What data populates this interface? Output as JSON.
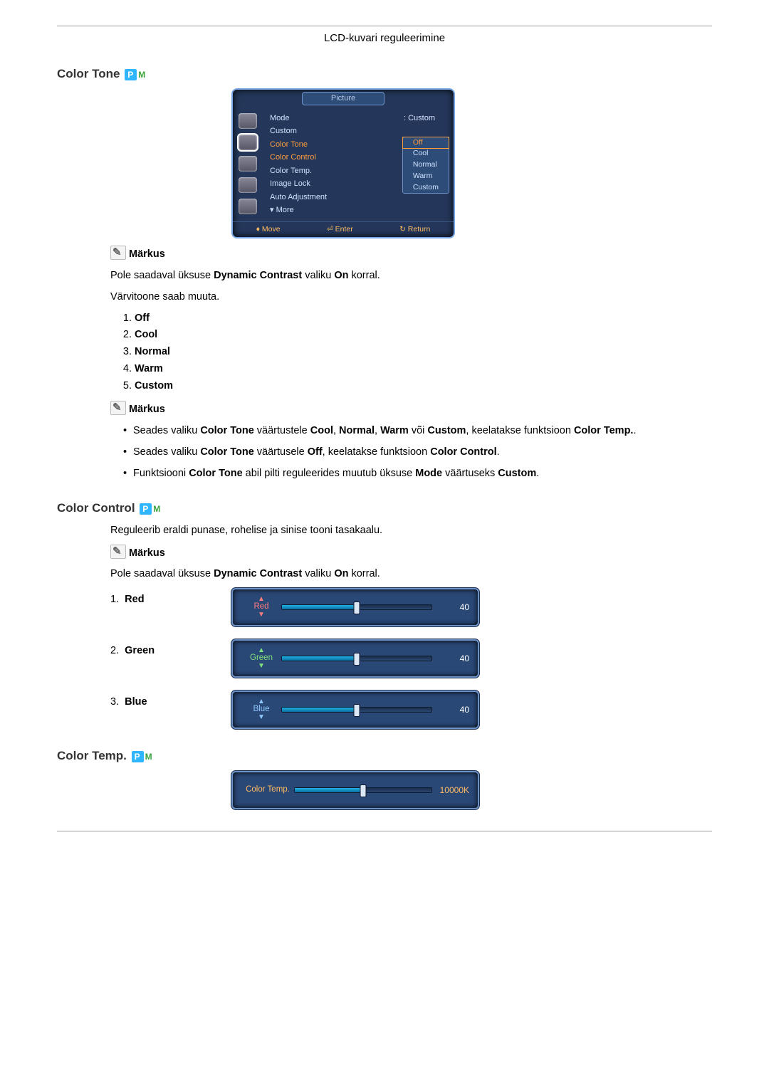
{
  "header": "LCD-kuvari reguleerimine",
  "sections": {
    "colorTone": {
      "title": "Color Tone",
      "osd": {
        "titlebar": "Picture",
        "rowMode": {
          "lbl": "Mode",
          "val": ": Custom"
        },
        "rowCustom": {
          "lbl": "Custom",
          "val": ""
        },
        "rowColorTone": {
          "lbl": "Color Tone",
          "val": ": Off"
        },
        "rowColorControl": {
          "lbl": "Color Control",
          "val": ""
        },
        "rowColorTemp": {
          "lbl": "Color Temp.",
          "val": ":"
        },
        "rowImageLock": {
          "lbl": "Image Lock",
          "val": ":"
        },
        "rowAutoAdj": {
          "lbl": "Auto Adjustment",
          "val": ":"
        },
        "rowMore": {
          "lbl": "▾ More",
          "val": ""
        },
        "popup": {
          "opt1": "Off",
          "opt2": "Cool",
          "opt3": "Normal",
          "opt4": "Warm",
          "opt5": "Custom"
        },
        "footMove": "♦ Move",
        "footEnter": "⏎ Enter",
        "footReturn": "↻ Return"
      },
      "note1": "Märkus",
      "note1p1_a": "Pole saadaval üksuse ",
      "note1p1_b": "Dynamic Contrast",
      "note1p1_c": " valiku ",
      "note1p1_d": "On",
      "note1p1_e": " korral.",
      "note1p2": "Värvitoone saab muuta.",
      "opts": {
        "o1": "Off",
        "o2": "Cool",
        "o3": "Normal",
        "o4": "Warm",
        "o5": "Custom"
      },
      "note2": "Märkus",
      "bul1_a": "Seades valiku ",
      "bul1_b": "Color Tone",
      "bul1_c": " väärtustele ",
      "bul1_d": "Cool",
      "bul1_e": ", ",
      "bul1_f": "Normal",
      "bul1_g": ", ",
      "bul1_h": "Warm",
      "bul1_i": " või ",
      "bul1_j": "Custom",
      "bul1_k": ", keelatakse funktsioon ",
      "bul1_l": "Color Temp.",
      "bul1_m": ".",
      "bul2_a": "Seades valiku ",
      "bul2_b": "Color Tone",
      "bul2_c": " väärtusele ",
      "bul2_d": "Off",
      "bul2_e": ", keelatakse funktsioon ",
      "bul2_f": "Color Control",
      "bul2_g": ".",
      "bul3_a": "Funktsiooni ",
      "bul3_b": "Color Tone",
      "bul3_c": " abil pilti reguleerides muutub üksuse ",
      "bul3_d": "Mode",
      "bul3_e": " väärtuseks ",
      "bul3_f": "Custom",
      "bul3_g": "."
    },
    "colorControl": {
      "title": "Color Control",
      "intro": "Reguleerib eraldi punase, rohelise ja sinise tooni tasakaalu.",
      "note": "Märkus",
      "notep_a": "Pole saadaval üksuse ",
      "notep_b": "Dynamic Contrast",
      "notep_c": " valiku ",
      "notep_d": "On",
      "notep_e": " korral.",
      "items": {
        "r": "Red",
        "g": "Green",
        "b": "Blue"
      },
      "sliders": {
        "red": {
          "label": "Red",
          "value": "40"
        },
        "green": {
          "label": "Green",
          "value": "40"
        },
        "blue": {
          "label": "Blue",
          "value": "40"
        }
      }
    },
    "colorTemp": {
      "title": "Color Temp.",
      "slider": {
        "label": "Color Temp.",
        "value": "10000K"
      }
    }
  }
}
